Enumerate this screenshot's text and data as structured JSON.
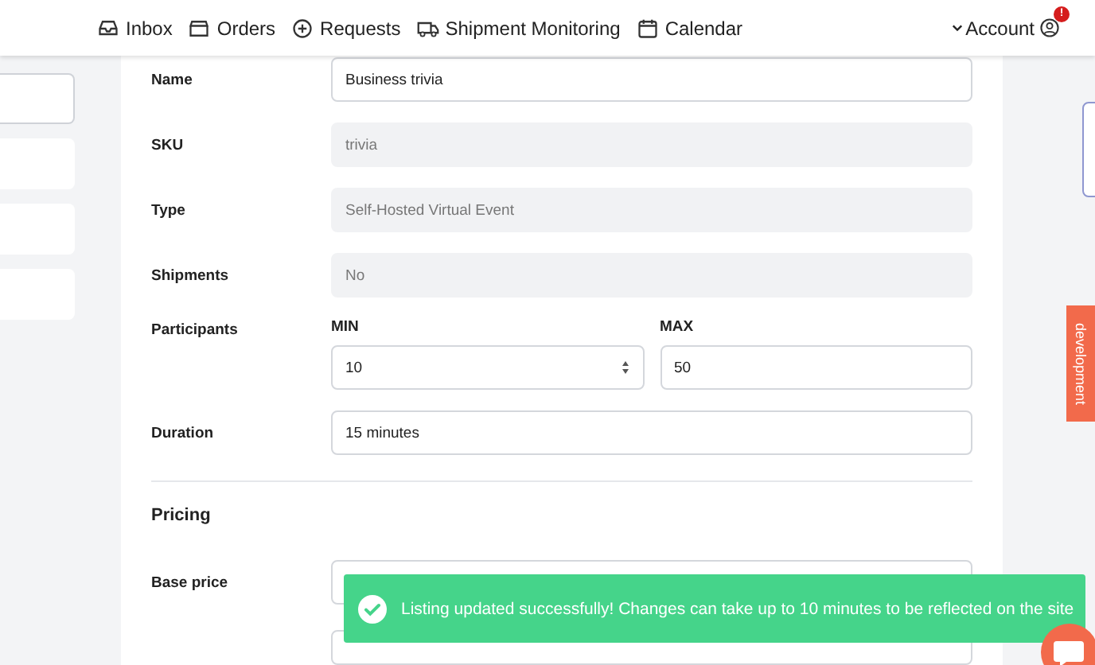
{
  "nav": {
    "items": [
      {
        "label": "Inbox"
      },
      {
        "label": "Orders"
      },
      {
        "label": "Requests"
      },
      {
        "label": "Shipment Monitoring"
      },
      {
        "label": "Calendar"
      }
    ],
    "account": {
      "label": "Account",
      "badge": "!"
    }
  },
  "form": {
    "fields": [
      {
        "label": "Name",
        "kind": "text",
        "value": "Business trivia",
        "disabled": false
      },
      {
        "label": "SKU",
        "kind": "text",
        "value": "trivia",
        "disabled": true
      },
      {
        "label": "Type",
        "kind": "text",
        "value": "Self-Hosted Virtual Event",
        "disabled": true
      },
      {
        "label": "Shipments",
        "kind": "text",
        "value": "No",
        "disabled": true
      },
      {
        "label": "Participants",
        "kind": "range",
        "min_label": "MIN",
        "min_value": "10",
        "max_label": "MAX",
        "max_value": "50"
      },
      {
        "label": "Duration",
        "kind": "text",
        "value": "15 minutes",
        "disabled": false
      }
    ],
    "section": "Pricing",
    "pricing_fields": [
      {
        "label": "Base price",
        "kind": "text",
        "disabled": false
      }
    ]
  },
  "side_tab": "development",
  "toast": {
    "message": "Listing updated successfully! Changes can take up to 10 minutes to be reflected on the site"
  }
}
